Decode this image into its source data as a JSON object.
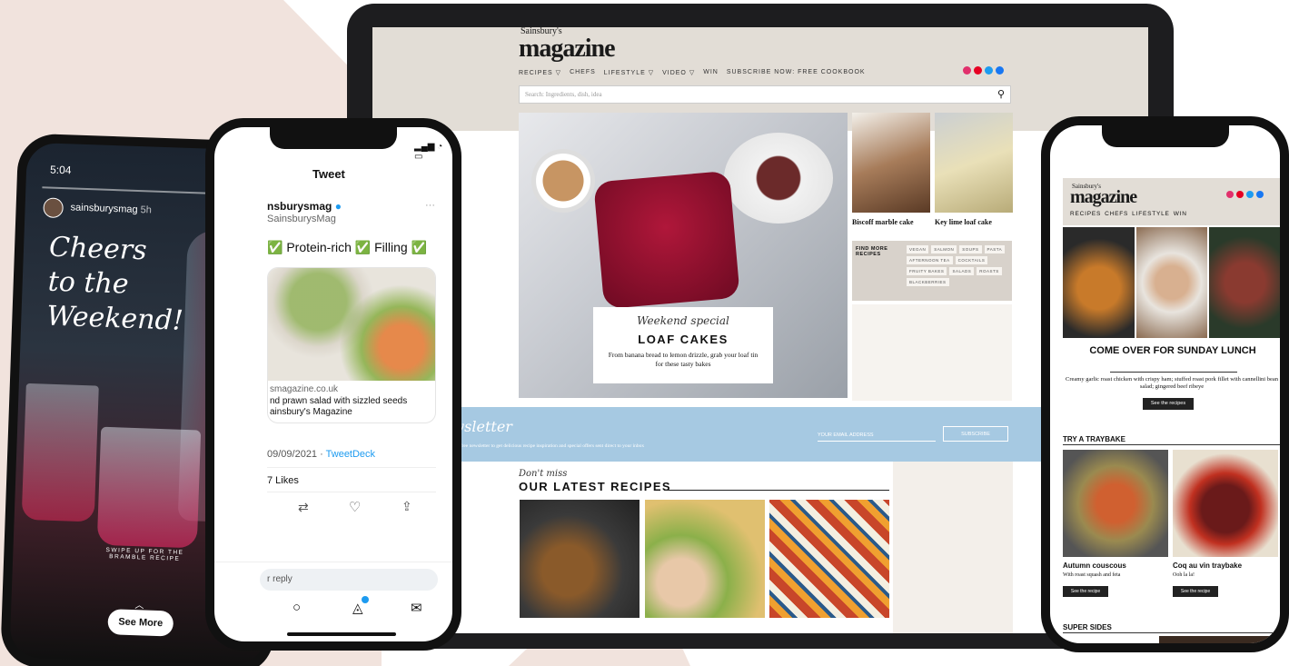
{
  "laptop": {
    "logo_small": "Sainsbury's",
    "logo": "magazine",
    "nav": [
      "RECIPES ▽",
      "CHEFS",
      "LIFESTYLE ▽",
      "VIDEO ▽",
      "WIN",
      "SUBSCRIBE NOW: FREE COOKBOOK"
    ],
    "search_placeholder": "Search: Ingredients, dish, idea",
    "hero": {
      "script": "Weekend special",
      "title": "LOAF CAKES",
      "desc": "From banana bread to lemon drizzle, grab your loaf tin for these tasty bakes"
    },
    "thumbs": [
      "Biscoff marble cake",
      "Key lime loaf cake"
    ],
    "find_more": "FIND MORE RECIPES",
    "tags": [
      "VEGAN",
      "SALMON",
      "SOUPS",
      "PASTA",
      "AFTERNOON TEA",
      "COCKTAILS",
      "FRUITY BAKES",
      "SALADS",
      "ROASTS",
      "BLACKBERRIES"
    ],
    "newsletter": {
      "title": "Newsletter",
      "sub": "Sign up to our free newsletter to get delicious recipe inspiration and special offers sent direct to your inbox",
      "email_placeholder": "YOUR EMAIL ADDRESS",
      "button": "SUBSCRIBE"
    },
    "dont_miss": "Don't miss",
    "latest": "OUR LATEST RECIPES"
  },
  "story": {
    "time": "5:04",
    "user": "sainsburysmag",
    "age": "5h",
    "headline": [
      "Cheers",
      "to the",
      "Weekend!"
    ],
    "swipe": "SWIPE UP FOR THE BRAMBLE RECIPE",
    "see_more": "See More"
  },
  "tweet": {
    "title": "Tweet",
    "name": "nsburysmag",
    "handle": "SainsburysMag",
    "text": "✅ Protein-rich ✅ Filling ✅",
    "link_domain": "smagazine.co.uk",
    "link_title": "nd prawn salad with sizzled seeds",
    "link_title2": "ainsbury's Magazine",
    "date": "09/09/2021 · ",
    "client": "TweetDeck",
    "likes": "7 Likes",
    "reply": "r reply"
  },
  "mobile": {
    "logo_small": "Sainsbury's",
    "logo": "magazine",
    "nav": [
      "RECIPES",
      "CHEFS",
      "LIFESTYLE",
      "WIN"
    ],
    "hero_title": "COME OVER FOR SUNDAY LUNCH",
    "hero_desc": "Creamy garlic roast chicken with crispy ham; stuffed roast pork fillet with cannellini bean salad; gingered beef ribeye",
    "hero_btn": "See the recipes",
    "section": "TRY A TRAYBAKE",
    "cards": [
      {
        "title": "Autumn couscous",
        "sub": "With roast squash and feta",
        "btn": "See the recipe"
      },
      {
        "title": "Coq au vin traybake",
        "sub": "Ooh la la!",
        "btn": "See the recipe"
      }
    ],
    "section2": "SUPER SIDES"
  },
  "colors": {
    "pink": "#f2e4de",
    "blue": "#a6c9e2",
    "twitter_blue": "#1d9bf0"
  }
}
